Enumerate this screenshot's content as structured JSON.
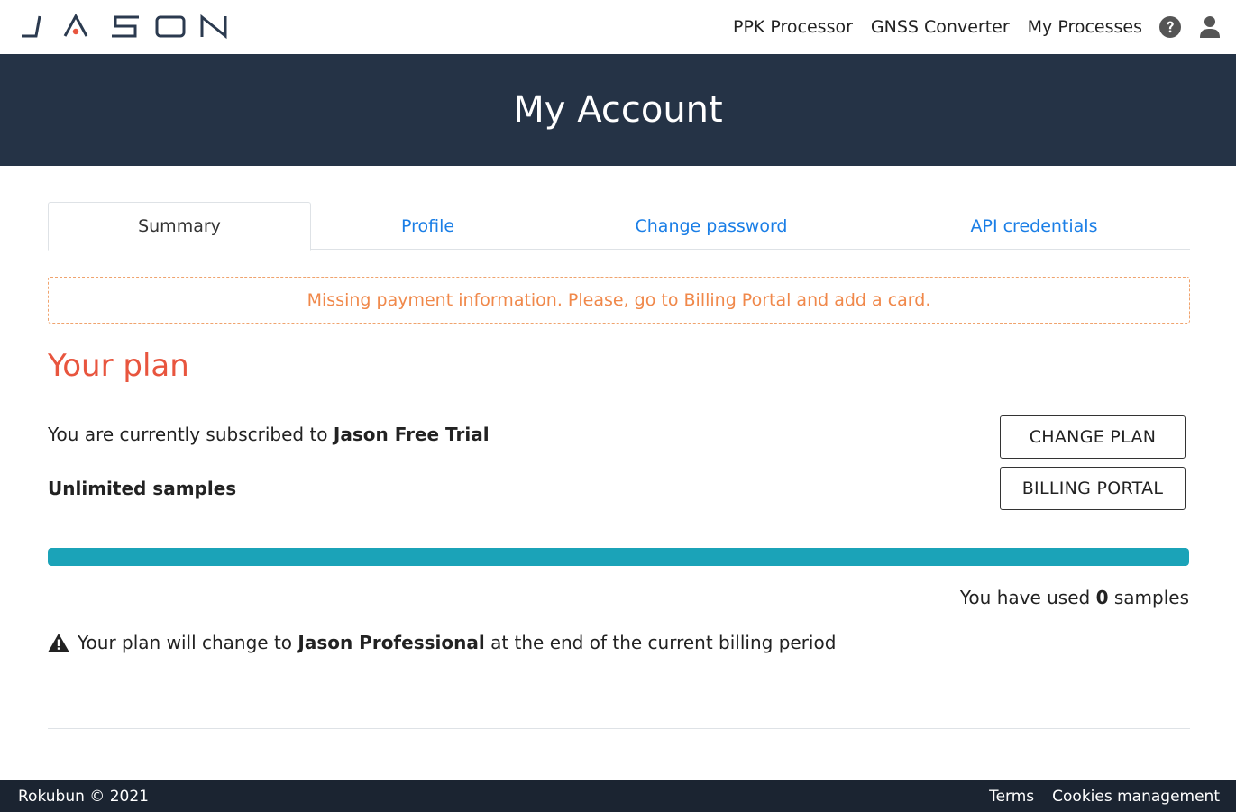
{
  "brand": {
    "logo_text": "JASON"
  },
  "nav": {
    "ppk_processor": "PPK Processor",
    "gnss_converter": "GNSS Converter",
    "my_processes": "My Processes"
  },
  "hero": {
    "title": "My Account"
  },
  "tabs": [
    {
      "label": "Summary",
      "active": true
    },
    {
      "label": "Profile",
      "active": false
    },
    {
      "label": "Change password",
      "active": false
    },
    {
      "label": "API credentials",
      "active": false
    }
  ],
  "alert": {
    "text": "Missing payment information. Please, go to Billing Portal and add a card."
  },
  "plan": {
    "title": "Your plan",
    "subscribed_prefix": "You are currently subscribed to ",
    "plan_name": "Jason Free Trial",
    "samples_text": "Unlimited samples",
    "change_plan_label": "CHANGE PLAN",
    "billing_portal_label": "BILLING PORTAL",
    "usage_fraction": 1.0,
    "used_prefix": "You have used ",
    "used_count": "0",
    "used_suffix": " samples",
    "change_prefix": "Your plan will change to ",
    "next_plan": "Jason Professional",
    "change_suffix": " at the end of the current billing period"
  },
  "footer": {
    "copyright": "Rokubun © 2021",
    "terms": "Terms",
    "cookies": "Cookies management"
  },
  "colors": {
    "hero_bg": "#253346",
    "accent_link": "#1a7ee6",
    "plan_title": "#e8553e",
    "alert": "#f0884a",
    "progress": "#1ba3b8",
    "footer_bg": "#1b2431"
  },
  "icons": {
    "help": "question-circle-icon",
    "user": "user-icon",
    "warning": "warning-triangle-icon"
  }
}
